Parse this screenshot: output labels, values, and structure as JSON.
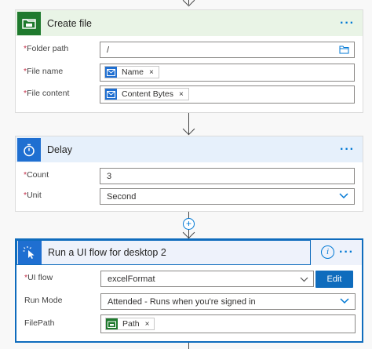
{
  "colors": {
    "create_file_header": "#e9f4e6",
    "create_file_icon": "#1f7a2e",
    "delay_header": "#e6f0fb",
    "delay_icon": "#1f6fd1",
    "desktop_header": "#eef2fb",
    "desktop_icon": "#1f6fd1",
    "accent": "#0078d4"
  },
  "create_file": {
    "title": "Create file",
    "folder_path_label": "Folder path",
    "folder_path_value": "/",
    "file_name_label": "File name",
    "file_name_token": "Name",
    "file_content_label": "File content",
    "file_content_token": "Content Bytes"
  },
  "delay": {
    "title": "Delay",
    "count_label": "Count",
    "count_value": "3",
    "unit_label": "Unit",
    "unit_value": "Second"
  },
  "desktop_flow": {
    "title": "Run a UI flow for desktop 2",
    "ui_flow_label": "UI flow",
    "ui_flow_value": "excelFormat",
    "edit_label": "Edit",
    "run_mode_label": "Run Mode",
    "run_mode_value": "Attended - Runs when you're signed in",
    "filepath_label": "FilePath",
    "filepath_token": "Path"
  },
  "common": {
    "required_marker": "*",
    "more_dots": "···",
    "token_remove": "×",
    "add_step": "+",
    "info": "i"
  }
}
